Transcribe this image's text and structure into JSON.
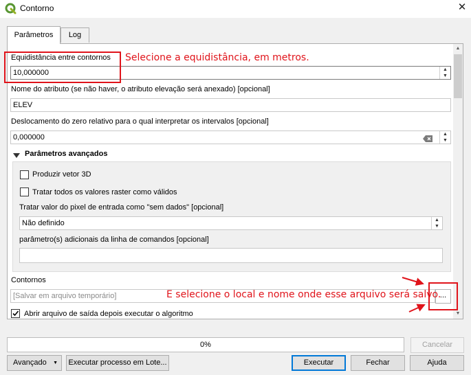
{
  "window": {
    "title": "Contorno",
    "close_glyph": "✕",
    "app_icon": "qgis-icon"
  },
  "tabs": [
    {
      "label": "Parâmetros",
      "active": true
    },
    {
      "label": "Log",
      "active": false
    }
  ],
  "params": {
    "interval_label": "Equidistância entre contornos",
    "interval_value": "10,000000",
    "attr_label": "Nome do atributo (se não haver, o atributo elevação será anexado)  [opcional]",
    "attr_value": "ELEV",
    "offset_label": "Deslocamento do zero relativo para o qual interpretar os intervalos [opcional]",
    "offset_value": "0,000000",
    "advanced_label": "Parâmetros avançados",
    "vector3d_label": "Produzir vetor 3D",
    "vector3d_checked": false,
    "allvalid_label": "Tratar todos os valores raster como válidos",
    "allvalid_checked": false,
    "nodata_label": "Tratar valor do pixel de entrada como \"sem dados\" [opcional]",
    "nodata_value": "Não definido",
    "extra_label": "parâmetro(s) adicionais da linha de comandos [opcional]",
    "extra_value": "",
    "output_label": "Contornos",
    "output_placeholder": "[Salvar em arquivo temporário]",
    "browse_label": "...",
    "open_output_label": "Abrir arquivo de saída depois executar o algoritmo",
    "open_output_checked": true
  },
  "annotations": {
    "note_interval": "Selecione a equidistância, em metros.",
    "note_output": "E selecione o local e nome onde esse arquivo será salvo.",
    "color": "#e0131a"
  },
  "progress": {
    "value": 0,
    "text": "0%"
  },
  "buttons": {
    "cancel": "Cancelar",
    "advanced": "Avançado",
    "batch": "Executar processo em Lote...",
    "run": "Executar",
    "close": "Fechar",
    "help": "Ajuda"
  }
}
